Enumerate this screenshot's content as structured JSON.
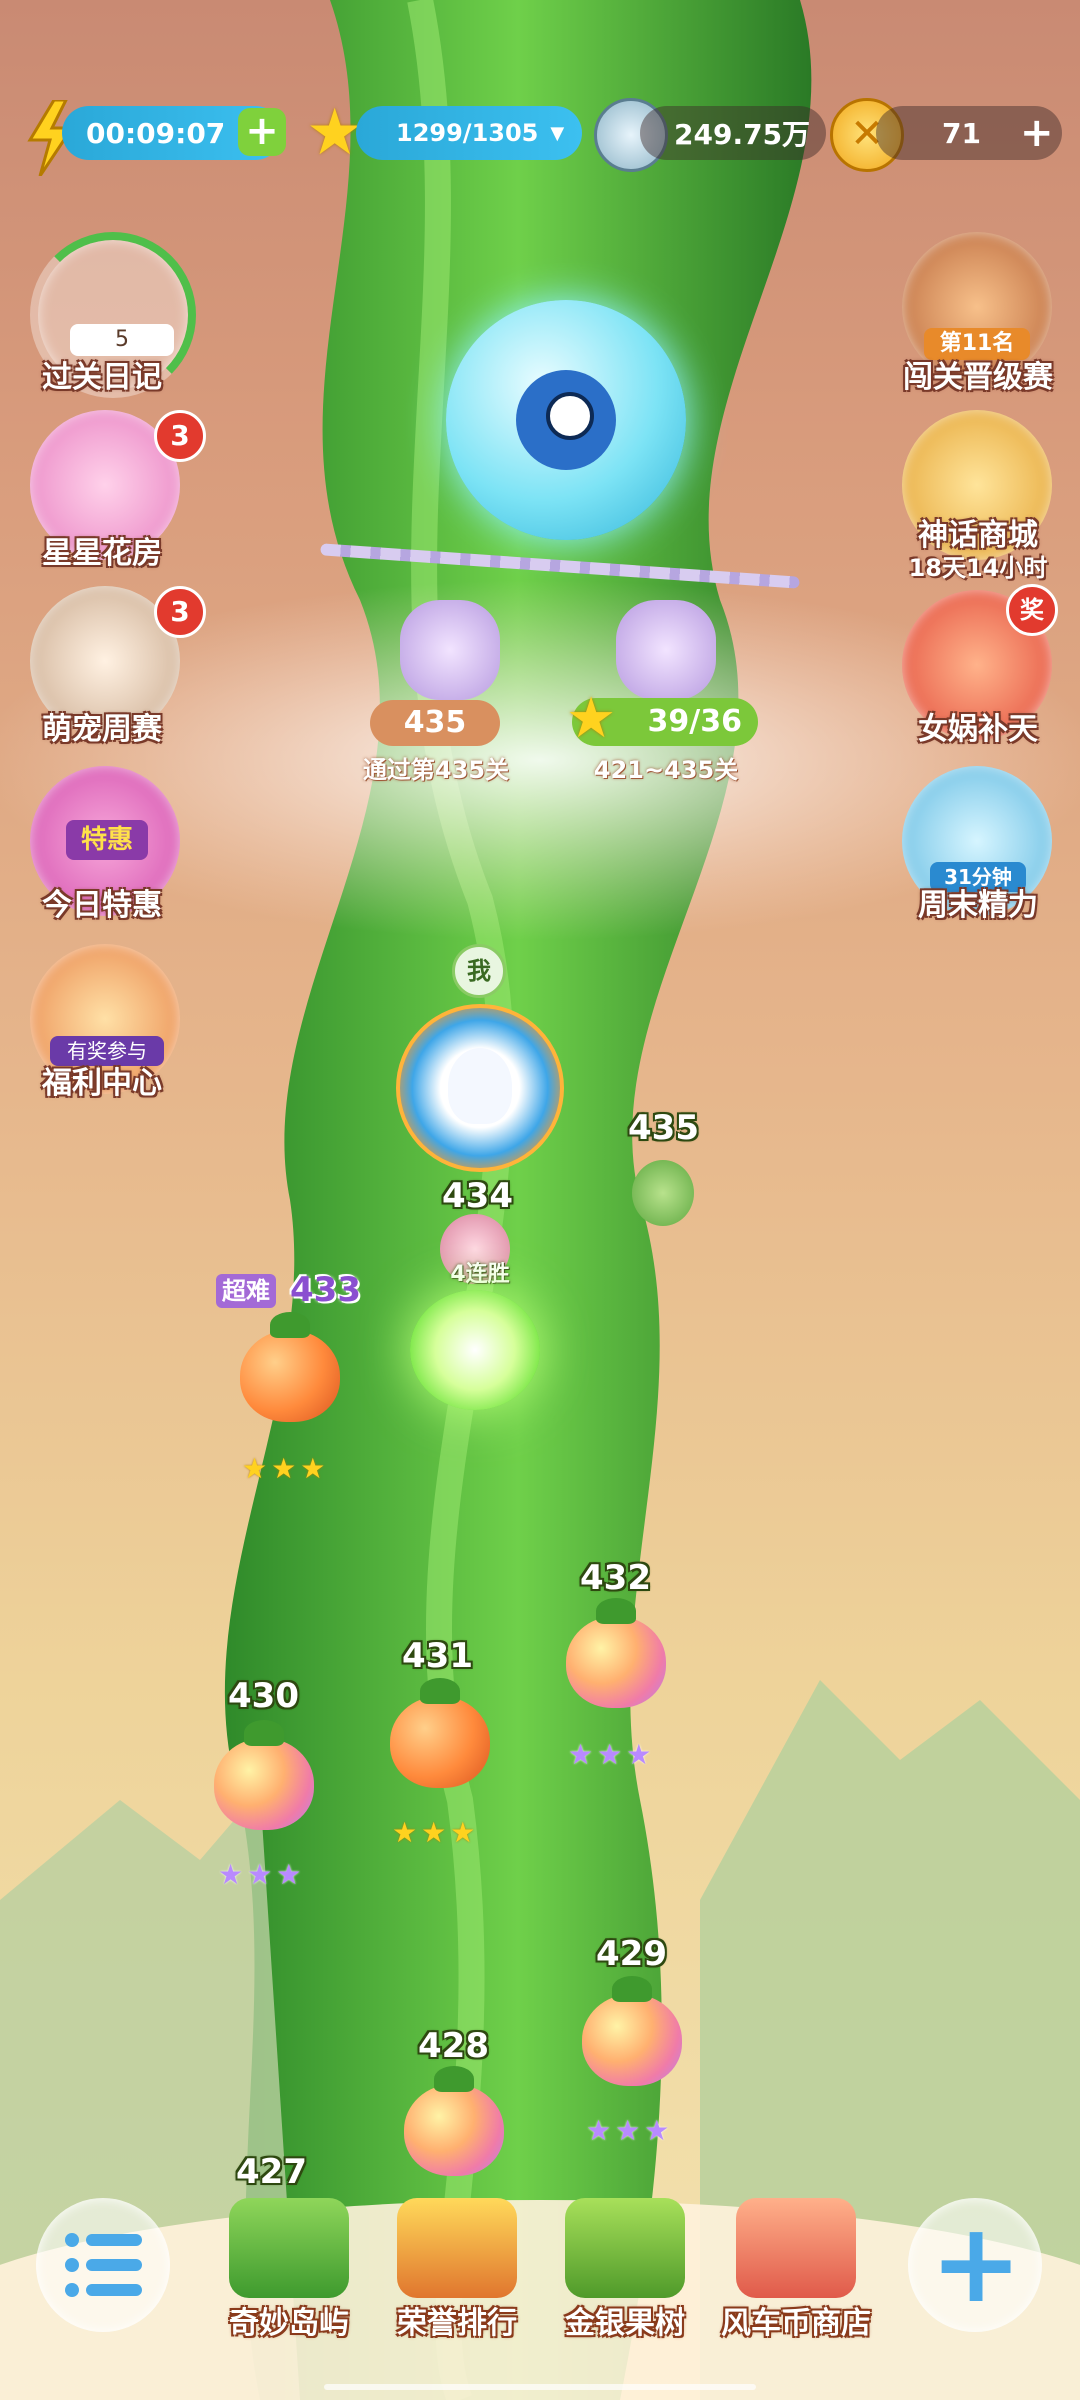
{
  "colors": {
    "accent_green": "#69c23a",
    "badge_red": "#e23a2e",
    "sky_top": "#c98a73",
    "sky_bottom": "#f3e3b0"
  },
  "top_bar": {
    "energy_timer": "00:09:07",
    "energy_plus": "+",
    "stars": "1299/1305",
    "stars_dropdown": "▼",
    "coins": "249.75万",
    "gold": "71",
    "gold_plus": "+"
  },
  "left_menu": [
    {
      "label": "过关日记",
      "sub": "5",
      "badge": ""
    },
    {
      "label": "星星花房",
      "sub": "",
      "badge": "3"
    },
    {
      "label": "萌宠周赛",
      "sub": "",
      "badge": "3"
    },
    {
      "label": "今日特惠",
      "sub": "特惠",
      "badge": ""
    },
    {
      "label": "福利中心",
      "sub": "有奖参与",
      "badge": ""
    }
  ],
  "right_menu": [
    {
      "label": "闯关晋级赛",
      "sub": "第11名",
      "badge": ""
    },
    {
      "label": "神话商城",
      "sub": "18天14小时",
      "badge": ""
    },
    {
      "label": "女娲补天",
      "sub": "",
      "badge": "奖"
    },
    {
      "label": "周末精力",
      "sub": "31分钟",
      "badge": ""
    }
  ],
  "gate": {
    "lock1_value": "435",
    "lock1_caption": "通过第435关",
    "lock2_value": "39/36",
    "lock2_caption": "421~435关"
  },
  "player": {
    "me_label": "我",
    "streak_label": "4连胜"
  },
  "levels": [
    {
      "num": "435",
      "difficulty": "",
      "stars": 0,
      "kind": "locked"
    },
    {
      "num": "434",
      "difficulty": "",
      "stars": 0,
      "kind": "current"
    },
    {
      "num": "433",
      "difficulty": "超难",
      "stars": 3,
      "kind": "gold"
    },
    {
      "num": "432",
      "difficulty": "",
      "stars": 3,
      "kind": "rainbow"
    },
    {
      "num": "431",
      "difficulty": "",
      "stars": 3,
      "kind": "gold"
    },
    {
      "num": "430",
      "difficulty": "",
      "stars": 3,
      "kind": "rainbow"
    },
    {
      "num": "429",
      "difficulty": "",
      "stars": 3,
      "kind": "rainbow"
    },
    {
      "num": "428",
      "difficulty": "",
      "stars": 0,
      "kind": "rainbow"
    },
    {
      "num": "427",
      "difficulty": "",
      "stars": 0,
      "kind": "rainbow"
    }
  ],
  "bottom_nav": [
    {
      "label": "奇妙岛屿"
    },
    {
      "label": "荣誉排行"
    },
    {
      "label": "金银果树"
    },
    {
      "label": "风车币商店"
    }
  ],
  "icons": {
    "menu": "menu-list-icon",
    "plus": "plus-icon",
    "lightning": "lightning-icon",
    "star": "star-icon",
    "coin": "silver-coin-icon",
    "gold": "gold-coin-icon"
  }
}
